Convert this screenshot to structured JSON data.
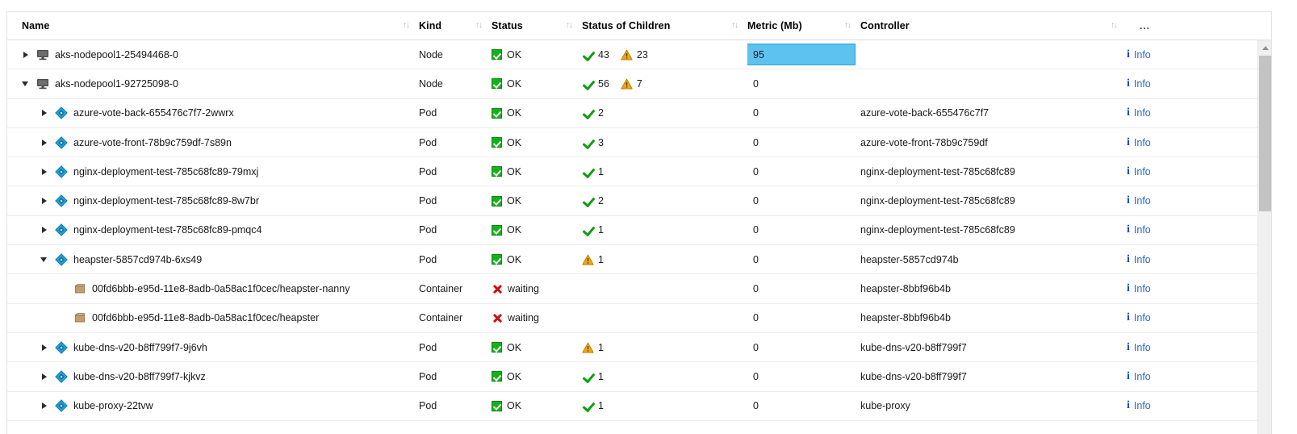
{
  "table": {
    "columns": [
      {
        "label": "Name",
        "sort_icon": "sort-arrows"
      },
      {
        "label": "Kind",
        "sort_icon": "sort-arrows"
      },
      {
        "label": "Status",
        "sort_icon": "sort-arrows"
      },
      {
        "label": "Status of Children",
        "sort_icon": "sort-arrows"
      },
      {
        "label": "Metric (Mb)",
        "sort_icon": "sort-arrows"
      },
      {
        "label": "Controller",
        "sort_icon": "sort-arrows"
      },
      {
        "label": "...",
        "sort_icon": ""
      }
    ],
    "info_label": "Info",
    "rows": [
      {
        "name": "aks-nodepool1-25494468-0",
        "icon": "node-icon",
        "indent": 0,
        "expander": "collapsed",
        "kind": "Node",
        "status": "OK",
        "status_icon": "green-check-box-icon",
        "children": [
          {
            "icon": "green-check-icon",
            "count": "43"
          },
          {
            "icon": "warning-triangle-icon",
            "count": "23"
          }
        ],
        "metric": "95",
        "metric_selected": true,
        "controller": "",
        "info": "Info"
      },
      {
        "name": "aks-nodepool1-92725098-0",
        "icon": "node-icon",
        "indent": 0,
        "expander": "expanded",
        "kind": "Node",
        "status": "OK",
        "status_icon": "green-check-box-icon",
        "children": [
          {
            "icon": "green-check-icon",
            "count": "56"
          },
          {
            "icon": "warning-triangle-icon",
            "count": "7"
          }
        ],
        "metric": "0",
        "metric_selected": false,
        "controller": "",
        "info": "Info"
      },
      {
        "name": "azure-vote-back-655476c7f7-2wwrx",
        "icon": "pod-icon",
        "indent": 1,
        "expander": "collapsed",
        "kind": "Pod",
        "status": "OK",
        "status_icon": "green-check-box-icon",
        "children": [
          {
            "icon": "green-check-icon",
            "count": "2"
          }
        ],
        "metric": "0",
        "metric_selected": false,
        "controller": "azure-vote-back-655476c7f7",
        "info": "Info"
      },
      {
        "name": "azure-vote-front-78b9c759df-7s89n",
        "icon": "pod-icon",
        "indent": 1,
        "expander": "collapsed",
        "kind": "Pod",
        "status": "OK",
        "status_icon": "green-check-box-icon",
        "children": [
          {
            "icon": "green-check-icon",
            "count": "3"
          }
        ],
        "metric": "0",
        "metric_selected": false,
        "controller": "azure-vote-front-78b9c759df",
        "info": "Info"
      },
      {
        "name": "nginx-deployment-test-785c68fc89-79mxj",
        "icon": "pod-icon",
        "indent": 1,
        "expander": "collapsed",
        "kind": "Pod",
        "status": "OK",
        "status_icon": "green-check-box-icon",
        "children": [
          {
            "icon": "green-check-icon",
            "count": "1"
          }
        ],
        "metric": "0",
        "metric_selected": false,
        "controller": "nginx-deployment-test-785c68fc89",
        "info": "Info"
      },
      {
        "name": "nginx-deployment-test-785c68fc89-8w7br",
        "icon": "pod-icon",
        "indent": 1,
        "expander": "collapsed",
        "kind": "Pod",
        "status": "OK",
        "status_icon": "green-check-box-icon",
        "children": [
          {
            "icon": "green-check-icon",
            "count": "2"
          }
        ],
        "metric": "0",
        "metric_selected": false,
        "controller": "nginx-deployment-test-785c68fc89",
        "info": "Info"
      },
      {
        "name": "nginx-deployment-test-785c68fc89-pmqc4",
        "icon": "pod-icon",
        "indent": 1,
        "expander": "collapsed",
        "kind": "Pod",
        "status": "OK",
        "status_icon": "green-check-box-icon",
        "children": [
          {
            "icon": "green-check-icon",
            "count": "1"
          }
        ],
        "metric": "0",
        "metric_selected": false,
        "controller": "nginx-deployment-test-785c68fc89",
        "info": "Info"
      },
      {
        "name": "heapster-5857cd974b-6xs49",
        "icon": "pod-icon",
        "indent": 1,
        "expander": "expanded",
        "kind": "Pod",
        "status": "OK",
        "status_icon": "green-check-box-icon",
        "children": [
          {
            "icon": "warning-triangle-icon",
            "count": "1"
          }
        ],
        "metric": "0",
        "metric_selected": false,
        "controller": "heapster-5857cd974b",
        "info": "Info"
      },
      {
        "name": "00fd6bbb-e95d-11e8-8adb-0a58ac1f0cec/heapster-nanny",
        "icon": "container-icon",
        "indent": 2,
        "expander": "none",
        "kind": "Container",
        "status": "waiting",
        "status_icon": "red-x-icon",
        "children": [],
        "metric": "0",
        "metric_selected": false,
        "controller": "heapster-8bbf96b4b",
        "info": "Info"
      },
      {
        "name": "00fd6bbb-e95d-11e8-8adb-0a58ac1f0cec/heapster",
        "icon": "container-icon",
        "indent": 2,
        "expander": "none",
        "kind": "Container",
        "status": "waiting",
        "status_icon": "red-x-icon",
        "children": [],
        "metric": "0",
        "metric_selected": false,
        "controller": "heapster-8bbf96b4b",
        "info": "Info"
      },
      {
        "name": "kube-dns-v20-b8ff799f7-9j6vh",
        "icon": "pod-icon",
        "indent": 1,
        "expander": "collapsed",
        "kind": "Pod",
        "status": "OK",
        "status_icon": "green-check-box-icon",
        "children": [
          {
            "icon": "warning-triangle-icon",
            "count": "1"
          }
        ],
        "metric": "0",
        "metric_selected": false,
        "controller": "kube-dns-v20-b8ff799f7",
        "info": "Info"
      },
      {
        "name": "kube-dns-v20-b8ff799f7-kjkvz",
        "icon": "pod-icon",
        "indent": 1,
        "expander": "collapsed",
        "kind": "Pod",
        "status": "OK",
        "status_icon": "green-check-box-icon",
        "children": [
          {
            "icon": "green-check-icon",
            "count": "1"
          }
        ],
        "metric": "0",
        "metric_selected": false,
        "controller": "kube-dns-v20-b8ff799f7",
        "info": "Info"
      },
      {
        "name": "kube-proxy-22tvw",
        "icon": "pod-icon",
        "indent": 1,
        "expander": "collapsed",
        "kind": "Pod",
        "status": "OK",
        "status_icon": "green-check-box-icon",
        "children": [
          {
            "icon": "green-check-icon",
            "count": "1"
          }
        ],
        "metric": "0",
        "metric_selected": false,
        "controller": "kube-proxy",
        "info": "Info"
      }
    ]
  },
  "colors": {
    "status_ok": "#15b01a",
    "status_error": "#cc1111",
    "warning": "#f0a816",
    "selection": "#5ec2f0",
    "link": "#2a66c8",
    "pod_icon": "#1ba1e2",
    "container_icon": "#c69c6d"
  },
  "scrollbar": {
    "up_arrow": "scroll-up-arrow-icon"
  }
}
